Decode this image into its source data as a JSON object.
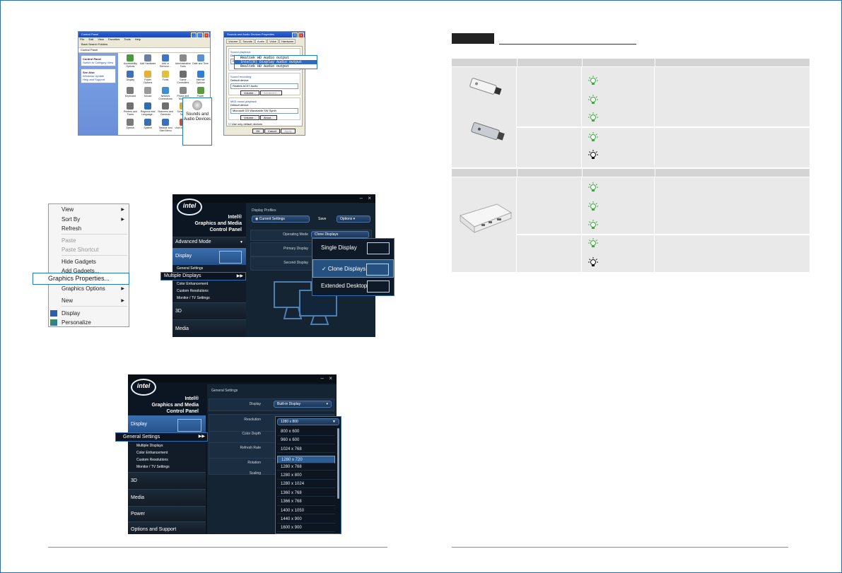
{
  "control_panel": {
    "title": "Control Panel",
    "menu": [
      "File",
      "Edit",
      "View",
      "Favorites",
      "Tools",
      "Help"
    ],
    "toolbar": "Back  Search  Folders",
    "address": "Control Panel",
    "left_pane": {
      "box1": "Control Panel",
      "box1_link": "Switch to Category View",
      "box2": "See Also",
      "box2_links": [
        "Windows Update",
        "Help and Support"
      ]
    },
    "icons": [
      {
        "label": "Accessibility Options",
        "color": "#4a9a3e"
      },
      {
        "label": "Add Hardware",
        "color": "#6b7fa3"
      },
      {
        "label": "Add or Remove...",
        "color": "#3f72c9"
      },
      {
        "label": "Administrative Tools",
        "color": "#8a8a8a"
      },
      {
        "label": "Date and Time",
        "color": "#5a8fd0"
      },
      {
        "label": "Display",
        "color": "#3f6fb5"
      },
      {
        "label": "Folder Options",
        "color": "#e2b23a"
      },
      {
        "label": "Fonts",
        "color": "#e0c040"
      },
      {
        "label": "Game Controllers",
        "color": "#6d6d6d"
      },
      {
        "label": "Internet Options",
        "color": "#2f7fd6"
      },
      {
        "label": "Keyboard",
        "color": "#7b7b7b"
      },
      {
        "label": "Mouse",
        "color": "#9a9a9a"
      },
      {
        "label": "Network Connections",
        "color": "#3f8fd0"
      },
      {
        "label": "Phone and Modem",
        "color": "#888888"
      },
      {
        "label": "Power Options",
        "color": "#5b9a3a"
      },
      {
        "label": "Printers and Faxes",
        "color": "#707070"
      },
      {
        "label": "Regional and Language...",
        "color": "#2f6fb0"
      },
      {
        "label": "Scanners and Cameras",
        "color": "#6e6e6e"
      },
      {
        "label": "Scheduled Tasks",
        "color": "#d8a83a"
      },
      {
        "label": "",
        "color": "#ffffff"
      },
      {
        "label": "Speech",
        "color": "#7a7a7a"
      },
      {
        "label": "System",
        "color": "#3a6fb0"
      },
      {
        "label": "Taskbar and Start Menu",
        "color": "#3b6fc0"
      },
      {
        "label": "User Accounts",
        "color": "#c0503a"
      },
      {
        "label": "",
        "color": "#ffffff"
      }
    ],
    "callout": "Sounds and Audio Devices"
  },
  "sound_dialog": {
    "title": "Sounds and Audio Devices Properties",
    "tabs": [
      "Volume",
      "Sounds",
      "Audio",
      "Voice",
      "Hardware"
    ],
    "group1": "Sound playback",
    "group1_label": "Default device:",
    "group1_value": "Realtek HD Audio output",
    "group2": "Sound recording",
    "group2_label": "Default device:",
    "group2_value": "Realtek AC97 Audio",
    "group3": "MIDI music playback",
    "group3_label": "Default device:",
    "group3_value": "Microsoft GS Wavetable SW Synth",
    "volume_btn": "Volume...",
    "advanced_btn": "Advanced...",
    "about_btn": "About...",
    "checkbox": "Use only default devices",
    "ok": "OK",
    "cancel": "Cancel",
    "apply": "Apply",
    "dropdown_items": [
      "Realtek HD Audio output",
      "Intel(R) Display Audio output",
      "Realtek HD Audio output"
    ]
  },
  "context_menu": {
    "items": [
      {
        "label": "View",
        "disabled": false,
        "arrow": true
      },
      {
        "label": "Sort By",
        "disabled": false,
        "arrow": true
      },
      {
        "label": "Refresh",
        "disabled": false,
        "arrow": false
      },
      {
        "label": "Paste",
        "disabled": true,
        "arrow": false
      },
      {
        "label": "Paste Shortcut",
        "disabled": true,
        "arrow": false
      },
      {
        "label": "Hide Gadgets",
        "disabled": false,
        "arrow": false
      },
      {
        "label": "Add Gadgets...",
        "disabled": false,
        "arrow": false
      },
      {
        "label": "Graphics Options",
        "disabled": false,
        "arrow": true
      },
      {
        "label": "New",
        "disabled": false,
        "arrow": true
      },
      {
        "label": "Display",
        "disabled": false,
        "arrow": false
      },
      {
        "label": "Personalize",
        "disabled": false,
        "arrow": false
      }
    ],
    "highlight": "Graphics Properties..."
  },
  "intel1": {
    "logo": "intel",
    "title_lines": [
      "Intel®",
      "Graphics and Media",
      "Control Panel"
    ],
    "advanced_mode": "Advanced Mode",
    "nav_display": "Display",
    "nav_general": "General Settings",
    "nav_multiple": "Multiple Displays",
    "nav_color": "Color Enhancement",
    "nav_custom": "Custom Resolutions",
    "nav_monitor": "Monitor / TV Settings",
    "nav_3d": "3D",
    "nav_media": "Media",
    "display_profiles": "Display Profiles",
    "current_settings": "Current Settings",
    "save": "Save",
    "options": "Options",
    "operating_mode": "Operating Mode",
    "operating_value": "Clone Displays",
    "primary_display": "Primary Display",
    "second_display": "Second Display",
    "popup_items": [
      "Single Display",
      "✓ Clone Displays",
      "Extended Desktop"
    ]
  },
  "intel2": {
    "logo": "intel",
    "title_lines": [
      "Intel®",
      "Graphics and Media",
      "Control Panel"
    ],
    "nav_display": "Display",
    "nav_general": "General Settings",
    "nav_multiple": "Multiple Displays",
    "nav_color": "Color Enhancement",
    "nav_custom": "Custom Resolutions",
    "nav_monitor": "Monitor / TV Settings",
    "nav_3d": "3D",
    "nav_media": "Media",
    "nav_power": "Power",
    "nav_options": "Options and Support",
    "general_settings": "General Settings",
    "display_label": "Display",
    "display_value": "Built-in Display",
    "resolution_label": "Resolution",
    "color_depth_label": "Color Depth",
    "refresh_label": "Refresh Rate",
    "rotation_label": "Rotation",
    "scaling_label": "Scaling",
    "resolution_value": "1280 x 800",
    "resolutions": [
      "800 x 600",
      "960 x 600",
      "1024 x 768",
      "1280 x 720",
      "1280 x 768",
      "1280 x 800",
      "1280 x 1024",
      "1360 x 768",
      "1366 x 768",
      "1400 x 1050",
      "1440 x 900",
      "1600 x 900"
    ],
    "selected_resolution": "1280 x 720"
  },
  "led_table": {
    "bulb_green": "#3aaa3a",
    "bulb_black": "#111111"
  }
}
